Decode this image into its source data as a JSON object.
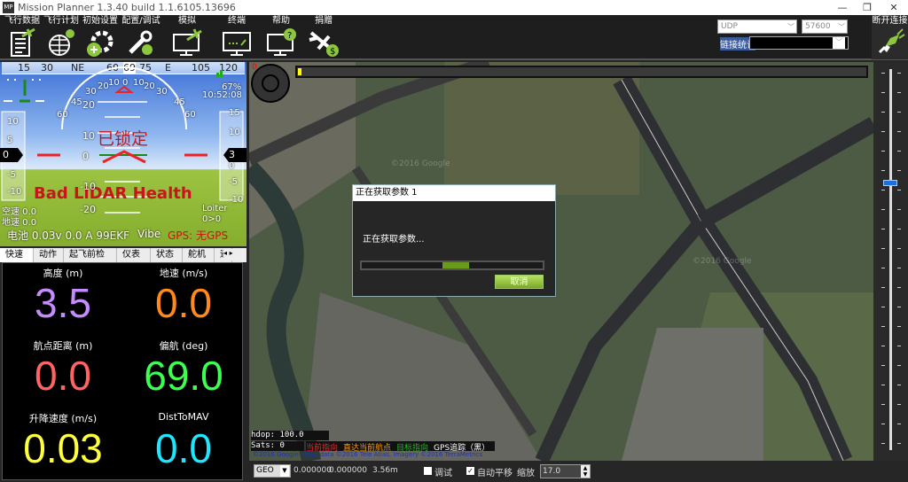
{
  "window": {
    "title": "Mission Planner 1.3.40 build 1.1.6105.13696",
    "logo": "MP"
  },
  "toolbar": {
    "items": [
      {
        "label": "飞行数据",
        "icon": "flight-data-icon"
      },
      {
        "label": "飞行计划",
        "icon": "flight-plan-icon"
      },
      {
        "label": "初始设置",
        "icon": "initial-setup-icon"
      },
      {
        "label": "配置/调试",
        "icon": "config-tuning-icon"
      },
      {
        "label": "模拟",
        "icon": "simulation-icon"
      },
      {
        "label": "终端",
        "icon": "terminal-icon"
      },
      {
        "label": "帮助",
        "icon": "help-icon"
      },
      {
        "label": "捐赠",
        "icon": "donate-icon"
      }
    ]
  },
  "connection": {
    "protocol": "UDP",
    "baud": "57600",
    "stats_label": "链接统计",
    "stats_value": "",
    "connect_label": "断开连接"
  },
  "hud": {
    "heading_ticks": [
      "15",
      "30",
      "NE",
      "60",
      "69",
      "75",
      "E",
      "105",
      "120"
    ],
    "heading_value": "69",
    "roll_ticks": [
      "60",
      "45",
      "30",
      "20",
      "10",
      "0",
      "10",
      "20",
      "30",
      "45",
      "60"
    ],
    "pitch_ticks": [
      "20",
      "10",
      "0",
      "-10",
      "-20"
    ],
    "status": "已锁定",
    "warning": "Bad LiDAR Health",
    "battery_pct": "67%",
    "time": "10:52:08",
    "speed_ticks": [
      "10",
      "5",
      "0",
      "-5",
      "-10"
    ],
    "speed_value": "0",
    "alt_ticks": [
      "15",
      "10",
      "5",
      "0",
      "-5",
      "-10"
    ],
    "alt_value": "3",
    "airspeed": "空速 0.0",
    "groundspeed": "地速 0.0",
    "mode": "Loiter",
    "wp": "0>0",
    "battery_line": "电池 0.03v 0.0 A 99EKF",
    "vibe": "Vibe",
    "gps": "GPS: 无GPS"
  },
  "tabs": [
    "快速",
    "动作",
    "起飞前检查",
    "仪表",
    "状态",
    "舵机",
    "遥"
  ],
  "quick": [
    {
      "label": "高度 (m)",
      "value": "3.5",
      "color": "#c68cff"
    },
    {
      "label": "地速 (m/s)",
      "value": "0.0",
      "color": "#ff8a1c"
    },
    {
      "label": "航点距离 (m)",
      "value": "0.0",
      "color": "#ff6464"
    },
    {
      "label": "偏航 (deg)",
      "value": "69.0",
      "color": "#3cff50"
    },
    {
      "label": "升降速度 (m/s)",
      "value": "0.03",
      "color": "#ffff3c"
    },
    {
      "label": "DistToMAV",
      "value": "0.0",
      "color": "#1ee6ff"
    }
  ],
  "map": {
    "throttle_label": "0",
    "hdop": "hdop: 100.0",
    "sats": "Sats: 0",
    "legend": [
      {
        "text": "当前指向",
        "color": "#ff2020"
      },
      {
        "text": "直达当前航点",
        "color": "#ff9900"
      },
      {
        "text": "目标指向",
        "color": "#22bb22"
      },
      {
        "text": "GPS追踪（黑）",
        "color": "#ffffff"
      }
    ],
    "copyright": "©2016 Google - Map data ©2016 Tele Atlas, Imagery ©2016 TerraMetrics",
    "watermark": "©2016 Google"
  },
  "dialog": {
    "title": "正在获取参数 1",
    "message": "正在获取参数...",
    "progress": 0.15,
    "cancel": "取消"
  },
  "bottom": {
    "coord_system": "GEO",
    "lat": "0.000000",
    "lng": "0.000000",
    "alt": "3.56m",
    "debug_label": "调试",
    "debug_checked": false,
    "autopan_label": "自动平移",
    "autopan_checked": true,
    "zoom_label": "缩放",
    "zoom_value": "17.0"
  }
}
